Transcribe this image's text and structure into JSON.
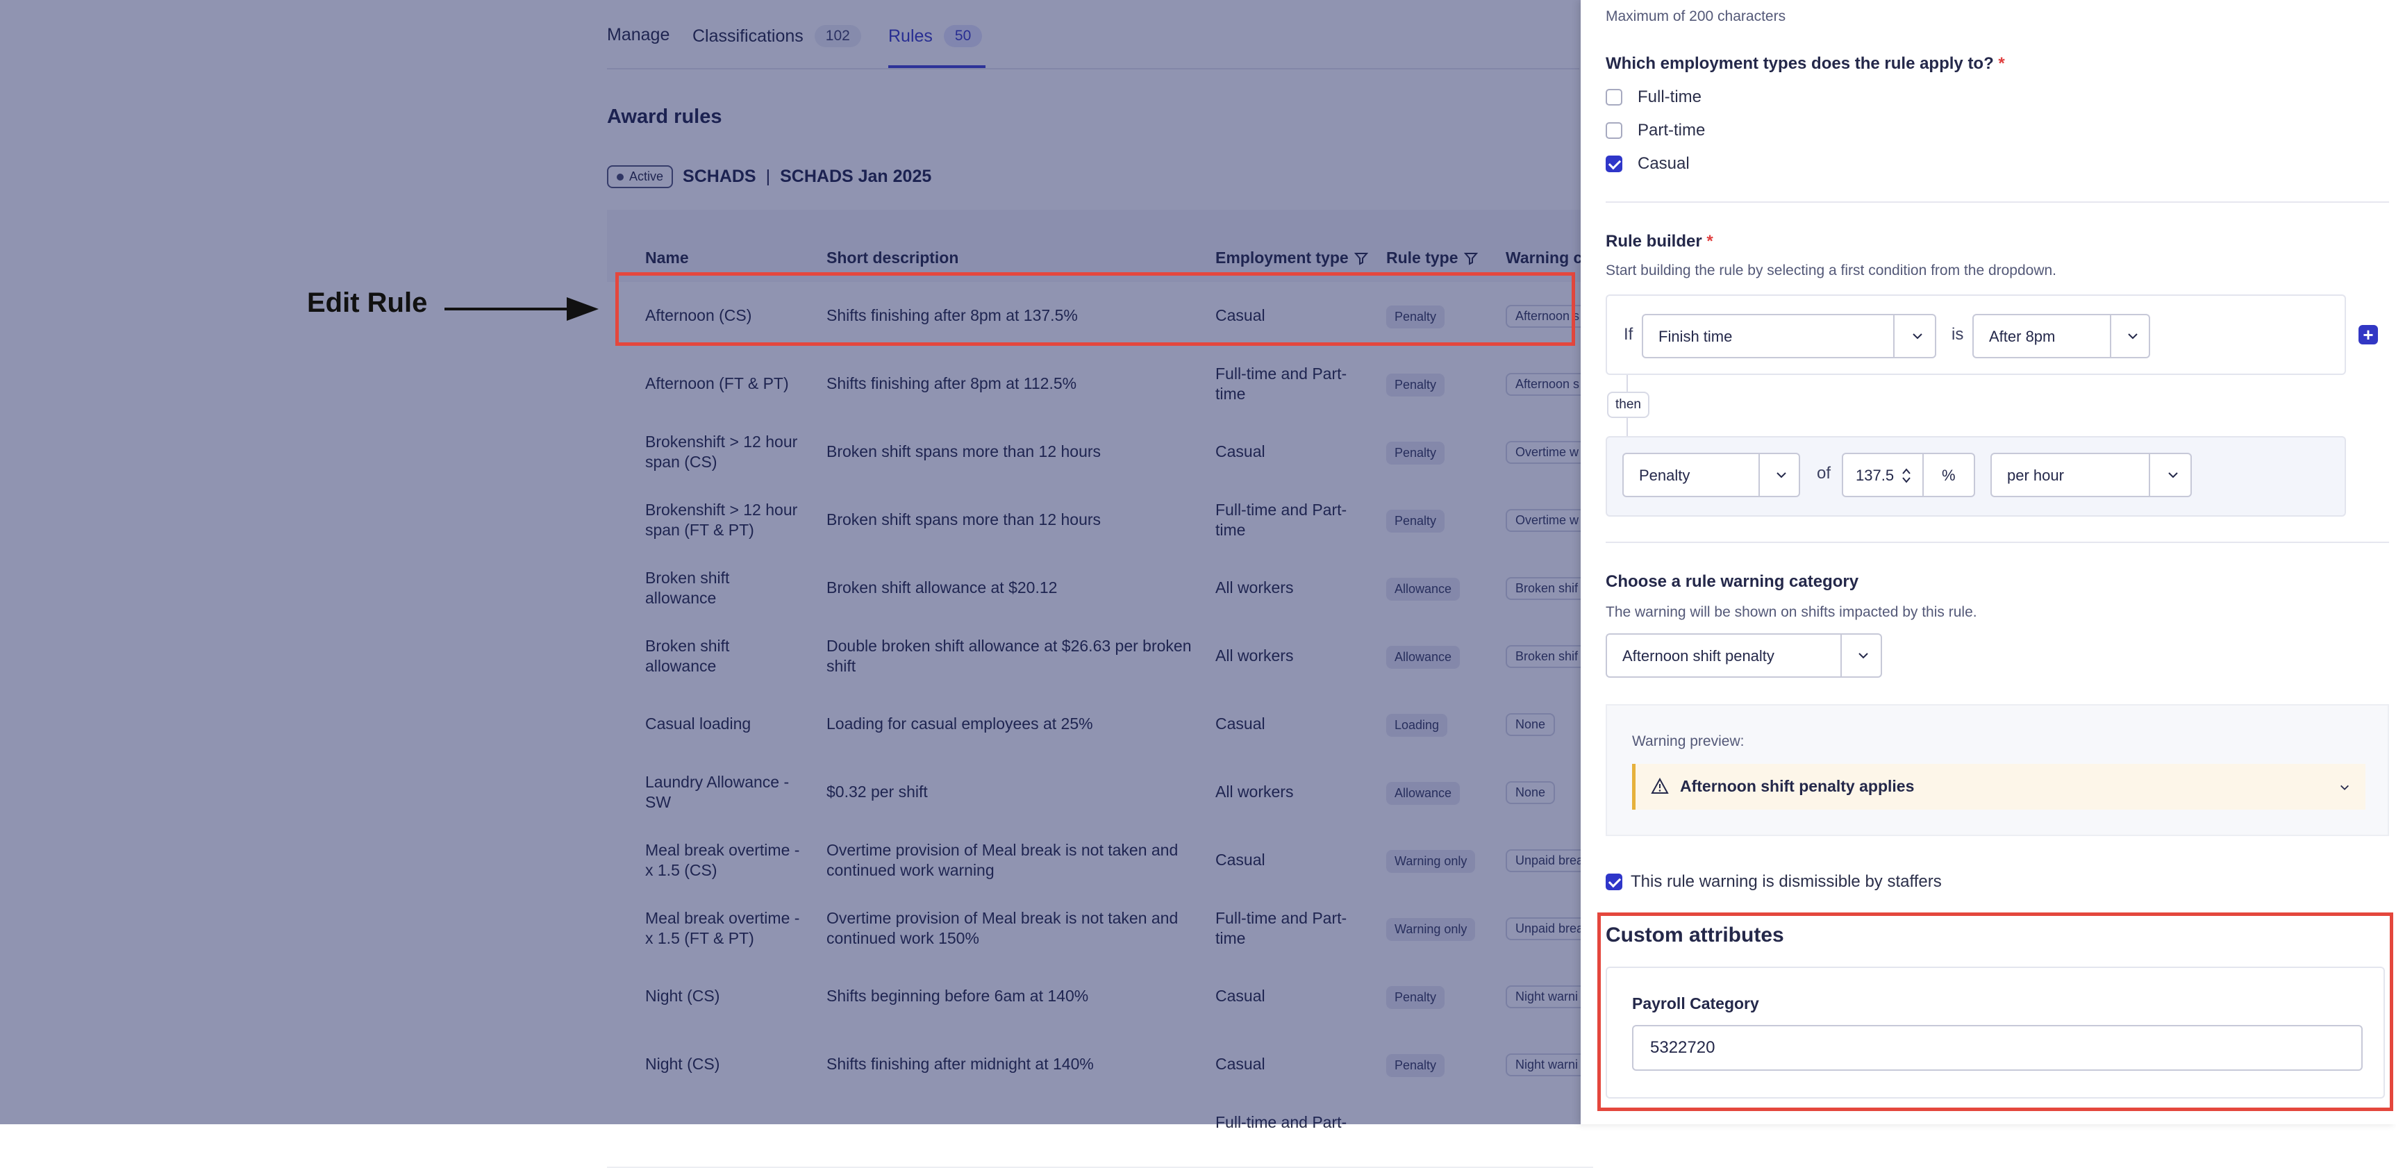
{
  "tabs": [
    {
      "label": "Manage",
      "count": ""
    },
    {
      "label": "Classifications",
      "count": "102"
    },
    {
      "label": "Rules",
      "count": "50"
    }
  ],
  "award": {
    "title": "Award rules",
    "status": "Active",
    "name": "SCHADS",
    "separator": "|",
    "version": "SCHADS Jan 2025"
  },
  "table": {
    "headers": [
      "Name",
      "Short description",
      "Employment type",
      "Rule type",
      "Warning c"
    ],
    "rows": [
      {
        "name": "Afternoon (CS)",
        "desc": "Shifts finishing after 8pm at 137.5%",
        "emp": "Casual",
        "type": "Penalty",
        "warning": "Afternoon s"
      },
      {
        "name": "Afternoon (FT & PT)",
        "desc": "Shifts finishing after 8pm at 112.5%",
        "emp": "Full-time and Part-time",
        "type": "Penalty",
        "warning": "Afternoon s"
      },
      {
        "name": "Brokenshift > 12 hour span (CS)",
        "desc": "Broken shift spans more than 12 hours",
        "emp": "Casual",
        "type": "Penalty",
        "warning": "Overtime w"
      },
      {
        "name": "Brokenshift > 12 hour span (FT & PT)",
        "desc": "Broken shift spans more than 12 hours",
        "emp": "Full-time and Part-time",
        "type": "Penalty",
        "warning": "Overtime w"
      },
      {
        "name": "Broken shift allowance",
        "desc": "Broken shift allowance at $20.12",
        "emp": "All workers",
        "type": "Allowance",
        "warning": "Broken shif"
      },
      {
        "name": "Broken shift allowance",
        "desc": "Double broken shift allowance at $26.63 per broken shift",
        "emp": "All workers",
        "type": "Allowance",
        "warning": "Broken shif"
      },
      {
        "name": "Casual loading",
        "desc": "Loading for casual employees at 25%",
        "emp": "Casual",
        "type": "Loading",
        "warning": "None"
      },
      {
        "name": "Laundry Allowance - SW",
        "desc": "$0.32 per shift",
        "emp": "All workers",
        "type": "Allowance",
        "warning": "None"
      },
      {
        "name": "Meal break overtime - x 1.5 (CS)",
        "desc": "Overtime provision of Meal break is not taken and continued work warning",
        "emp": "Casual",
        "type": "Warning only",
        "warning": "Unpaid brea"
      },
      {
        "name": "Meal break overtime - x 1.5 (FT & PT)",
        "desc": "Overtime provision of Meal break is not taken and continued work 150%",
        "emp": "Full-time and Part-time",
        "type": "Warning only",
        "warning": "Unpaid brea"
      },
      {
        "name": "Night (CS)",
        "desc": "Shifts beginning before 6am at 140%",
        "emp": "Casual",
        "type": "Penalty",
        "warning": "Night warni"
      },
      {
        "name": "Night (CS)",
        "desc": "Shifts finishing after midnight at 140%",
        "emp": "Casual",
        "type": "Penalty",
        "warning": "Night warni"
      },
      {
        "name": "",
        "desc": "",
        "emp": "Full-time and Part-",
        "type": "",
        "warning": ""
      }
    ]
  },
  "annotation": {
    "label": "Edit Rule"
  },
  "panel": {
    "max_chars_hint": "Maximum of 200 characters",
    "employment_question": "Which employment types does the rule apply to?",
    "required_mark": "*",
    "employment_options": [
      {
        "label": "Full-time",
        "checked": false
      },
      {
        "label": "Part-time",
        "checked": false
      },
      {
        "label": "Casual",
        "checked": true
      }
    ],
    "rule_builder_title": "Rule builder",
    "rule_builder_hint": "Start building the rule by selecting a first condition from the dropdown.",
    "condition": {
      "if_word": "If",
      "field": "Finish time",
      "is_word": "is",
      "value": "After 8pm",
      "then_word": "then",
      "action": "Penalty",
      "of_word": "of",
      "amount": "137.5",
      "unit_symbol": "%",
      "per": "per hour"
    },
    "warning_category_title": "Choose a rule warning category",
    "warning_category_hint": "The warning will be shown on shifts impacted by this rule.",
    "warning_category_value": "Afternoon shift penalty",
    "preview_label": "Warning preview:",
    "preview_text": "Afternoon shift penalty applies",
    "dismissible_label": "This rule warning is dismissible by staffers",
    "dismissible_checked": true,
    "custom_attributes_title": "Custom attributes",
    "payroll_category_label": "Payroll Category",
    "payroll_category_value": "5322720"
  },
  "colors": {
    "accent": "#3c3fc4",
    "highlight": "#e4473d",
    "overlay": "#141c5a"
  }
}
